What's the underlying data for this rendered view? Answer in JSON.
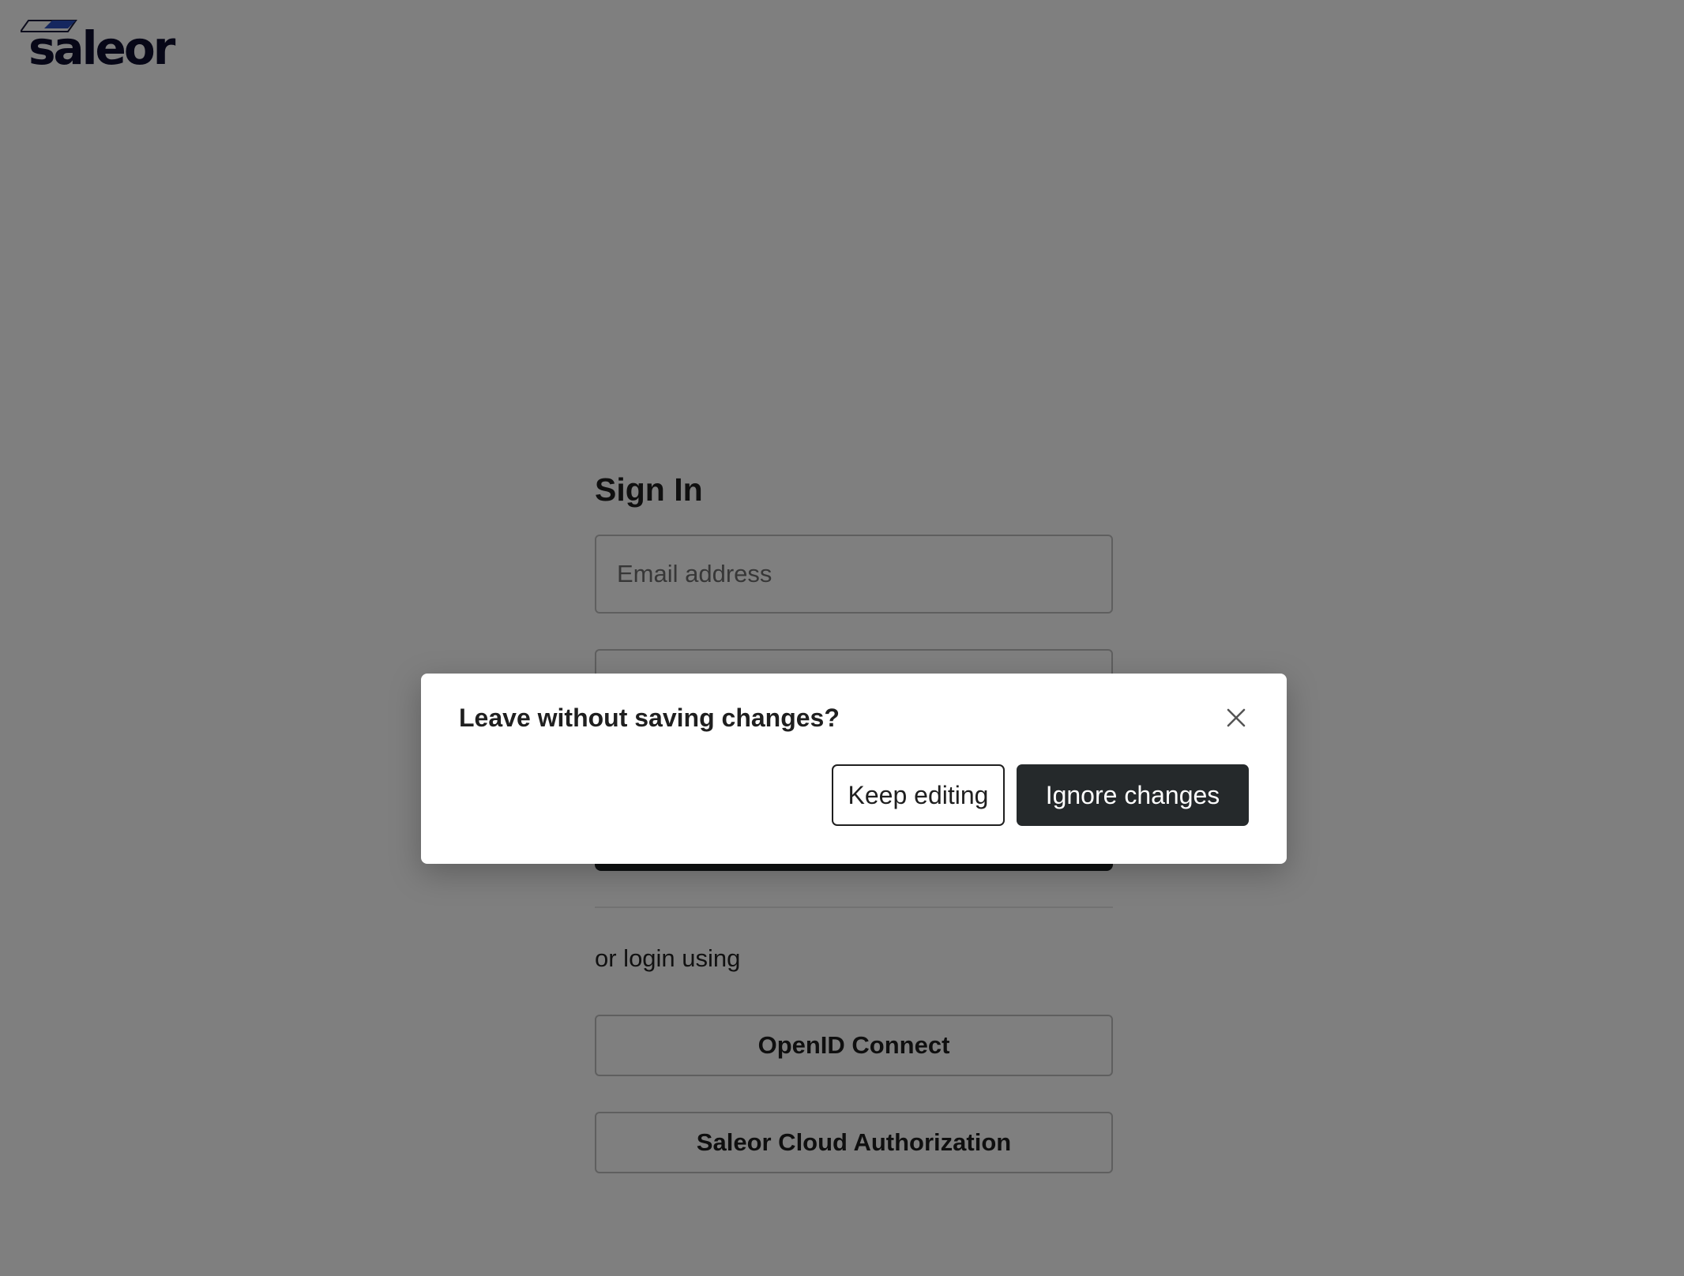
{
  "brand": {
    "logo_text": "saleor",
    "logo_icon": "saleor-logo-icon",
    "colors": {
      "logo_text": "#0f0f2e",
      "logo_mark": "#2a4fbf"
    }
  },
  "signin": {
    "title": "Sign In",
    "email_placeholder": "Email address",
    "password_placeholder": "",
    "or_login_text": "or login using",
    "sso_buttons": [
      {
        "label": "OpenID Connect"
      },
      {
        "label": "Saleor Cloud Authorization"
      }
    ]
  },
  "dialog": {
    "title": "Leave without saving changes?",
    "close_icon": "close-icon",
    "keep_label": "Keep editing",
    "ignore_label": "Ignore changes"
  },
  "colors": {
    "overlay": "rgba(0,0,0,0.5)",
    "primary_button": "#25292b"
  }
}
